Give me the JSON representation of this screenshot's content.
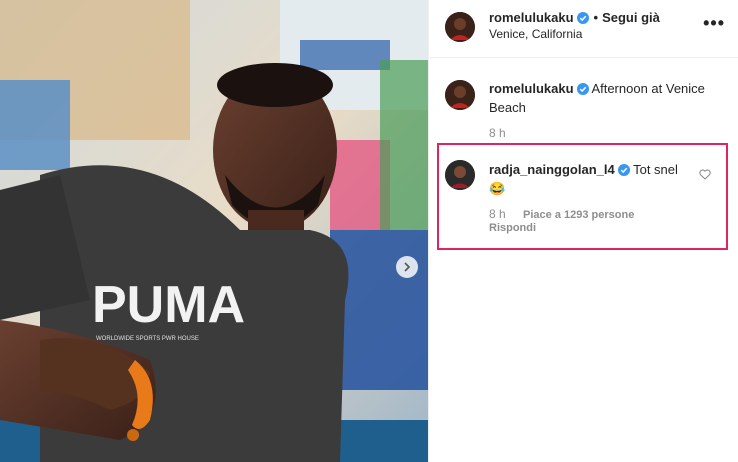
{
  "post": {
    "author": "romelulukaku",
    "follow_status": "Segui già",
    "location": "Venice, California",
    "more_label": "•••",
    "caption_text": "Afternoon at Venice Beach",
    "caption_time": "8 h",
    "photo_shirt_text": "PUMA",
    "photo_small_text": "WORLDWIDE SPORTS PWR HOUSE"
  },
  "comment": {
    "author": "radja_nainggolan_l4",
    "text": "Tot snel",
    "emoji": "😂",
    "time": "8 h",
    "likes": "Piace a 1293 persone",
    "reply": "Rispondi"
  },
  "colors": {
    "verified": "#3897f0",
    "highlight": "#e0245e",
    "muted": "#8e8e8e"
  }
}
